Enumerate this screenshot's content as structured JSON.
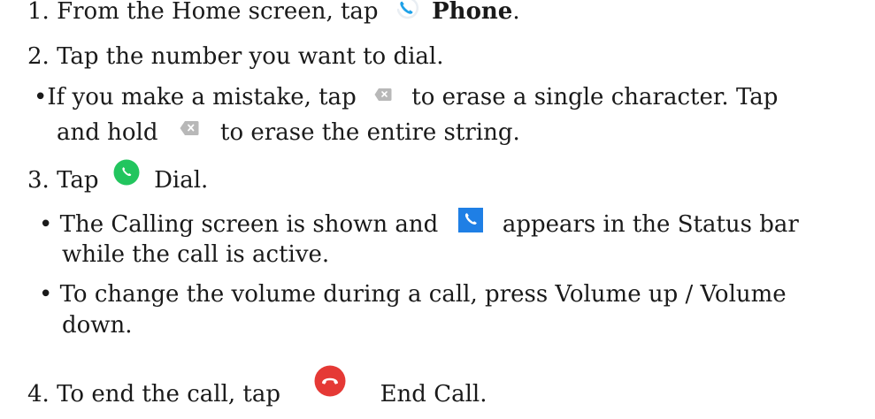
{
  "steps": {
    "s1": {
      "num": "1.",
      "pre": "From the Home screen, tap",
      "icon": "phone-app-icon",
      "bold": "Phone",
      "post": "."
    },
    "s2": {
      "num": "2.",
      "text": "Tap the number you want to dial."
    },
    "s2b": {
      "bullet": "•",
      "pre": "If you make a mistake, tap",
      "icon1": "backspace-icon",
      "mid": "to erase a single character. Tap",
      "line2_pre": "and hold",
      "icon2": "backspace-icon",
      "line2_post": "to erase the entire string."
    },
    "s3": {
      "num": "3.",
      "pre": "Tap",
      "icon": "green-dial-icon",
      "post": "Dial."
    },
    "s3b1": {
      "bullet": "•",
      "pre": "The Calling screen is shown and",
      "icon": "status-call-icon",
      "post": "appears in the Status bar",
      "line2": "while the call is active."
    },
    "s3b2": {
      "bullet": "•",
      "line1": "To change the volume during a call, press Volume up / Volume",
      "line2": "down."
    },
    "s4": {
      "num": "4.",
      "pre": "To end the call, tap",
      "icon": "end-call-icon",
      "post": "End Call."
    }
  },
  "colors": {
    "phone_blue": "#1ea1e8",
    "dial_green": "#22c55e",
    "status_blue": "#1f7fe5",
    "end_red": "#e53935",
    "backspace_gray": "#b8b8b8"
  }
}
